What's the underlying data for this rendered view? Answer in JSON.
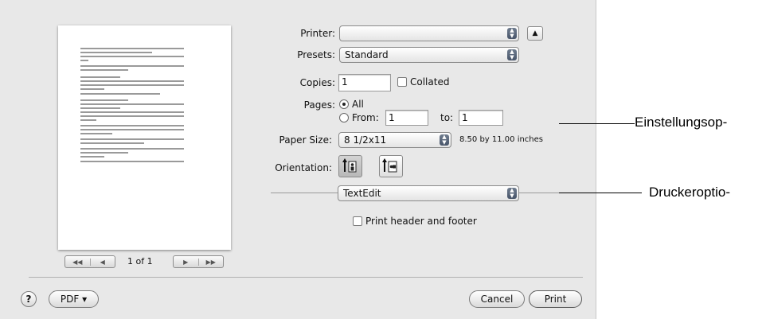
{
  "print_dialog": {
    "preview": {
      "page_indicator": "1 of 1",
      "first_prev_glyphs": [
        "◀◀",
        "◀"
      ],
      "next_last_glyphs": [
        "▶",
        "▶▶"
      ]
    },
    "printer": {
      "label": "Printer:",
      "value": ""
    },
    "presets": {
      "label": "Presets:",
      "value": "Standard"
    },
    "copies": {
      "label": "Copies:",
      "value": "1",
      "collated_label": "Collated",
      "collated_checked": false
    },
    "pages": {
      "label": "Pages:",
      "all_label": "All",
      "from_label": "From:",
      "from_value": "1",
      "to_label": "to:",
      "to_value": "1",
      "selected": "all"
    },
    "paper_size": {
      "label": "Paper Size:",
      "value": "8 1/2x11",
      "dimensions": "8.50 by 11.00 inches"
    },
    "orientation": {
      "label": "Orientation:",
      "selected": "portrait"
    },
    "app_options": {
      "value": "TextEdit",
      "header_footer_label": "Print header and footer",
      "header_footer_checked": false
    },
    "footer": {
      "help_label": "?",
      "pdf_label": "PDF ▾",
      "cancel_label": "Cancel",
      "print_label": "Print"
    }
  },
  "callouts": {
    "settings": "Einstellungsop-",
    "printer_options": "Druckeroptio-"
  },
  "colors": {
    "dialog_background": "#e8e8e8",
    "popup_arrow": "#5a6678"
  }
}
